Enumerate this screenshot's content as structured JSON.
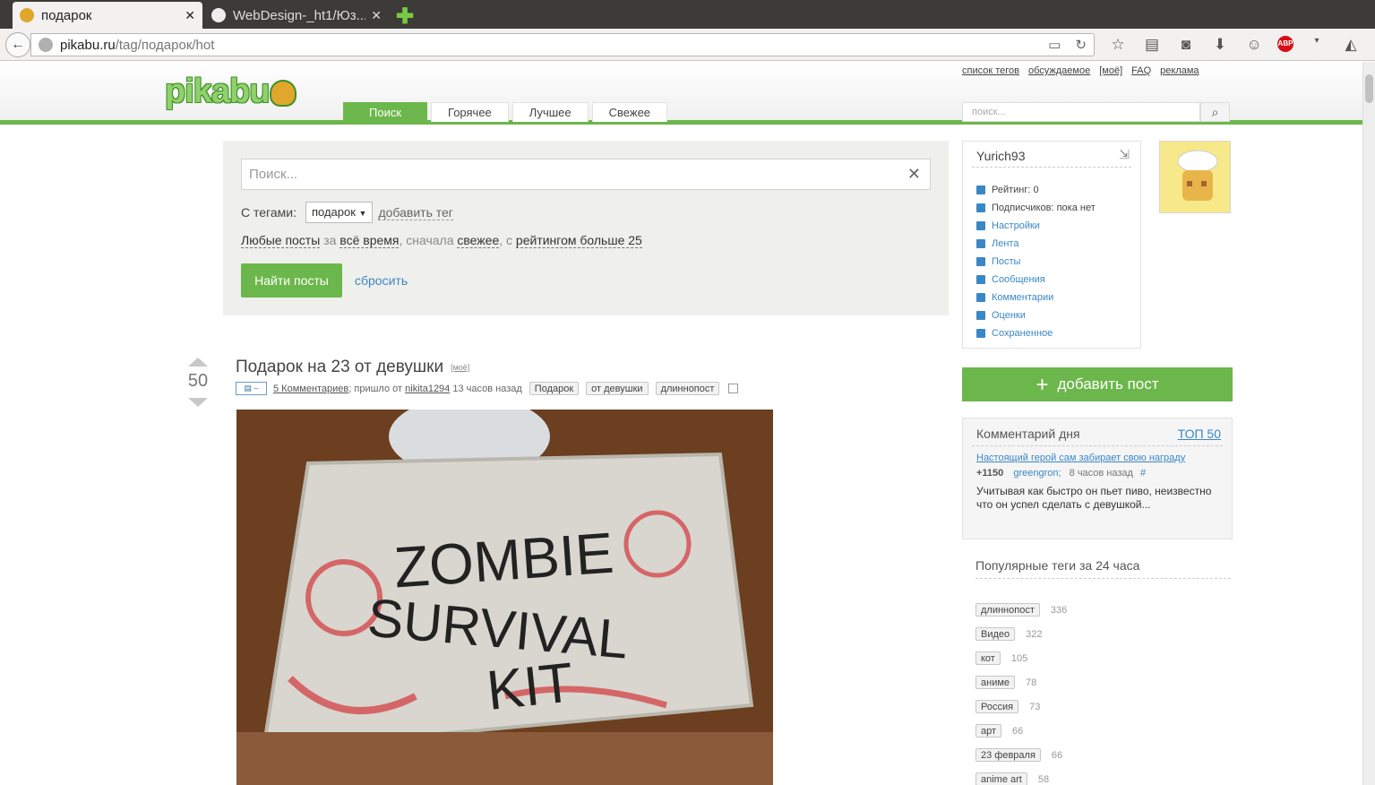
{
  "browser": {
    "tabs": [
      {
        "title": "подарок",
        "active": true
      },
      {
        "title": "WebDesign-_ht1/Юз...",
        "active": false
      }
    ],
    "url_host": "pikabu.ru",
    "url_path": "/tag/подарок/hot"
  },
  "header": {
    "logo_text": "pikabu",
    "top_links": [
      "список тегов",
      "обсуждаемое",
      "[моё]",
      "FAQ",
      "реклама"
    ],
    "nav_tabs": [
      "Поиск",
      "Горячее",
      "Лучшее",
      "Свежее"
    ],
    "search_placeholder": "поиск..."
  },
  "search_panel": {
    "placeholder": "Поиск...",
    "tags_label": "С тегами:",
    "selected_tag": "подарок",
    "add_tag": "добавить тег",
    "filter": {
      "any": "Любые посты",
      "w1": "за",
      "period": "всё время",
      "w2": ", сначала",
      "order": "свежее",
      "w3": ", с",
      "rating": "рейтингом больше 25"
    },
    "find_button": "Найти посты",
    "reset_link": "сбросить"
  },
  "post": {
    "score": "50",
    "title": "Подарок на 23 от девушки",
    "moe": "[моё]",
    "toggle": "▤ –",
    "comments_link": "5 Комментариев",
    "came_from": "; пришло от",
    "author": "nikita1294",
    "time": "13 часов назад",
    "tags": [
      "Подарок",
      "от девушки",
      "длиннопост"
    ],
    "image_text": [
      "ZOMBIE",
      "SURVIVAL",
      "KIT"
    ]
  },
  "user": {
    "name": "Yurich93",
    "rating": "Рейтинг: 0",
    "subscribers": "Подписчиков: пока нет",
    "menu": [
      "Настройки",
      "Лента",
      "Посты",
      "Сообщения",
      "Комментарии",
      "Оценки",
      "Сохраненное"
    ]
  },
  "add_post": "добавить пост",
  "comment_of_day": {
    "heading": "Комментарий дня",
    "top_link": "ТОП 50",
    "post_link": "Настоящий герой сам забирает свою награду",
    "rating": "+1150",
    "author": "greengron;",
    "time": "8 часов назад",
    "hash": "#",
    "text": "Учитывая как быстро он пьет пиво, неизвестно что он успел сделать с девушкой..."
  },
  "popular_tags": {
    "title": "Популярные теги за 24 часа",
    "items": [
      {
        "tag": "длиннопост",
        "count": "336"
      },
      {
        "tag": "Видео",
        "count": "322"
      },
      {
        "tag": "кот",
        "count": "105"
      },
      {
        "tag": "аниме",
        "count": "78"
      },
      {
        "tag": "Россия",
        "count": "73"
      },
      {
        "tag": "арт",
        "count": "66"
      },
      {
        "tag": "23 февраля",
        "count": "66"
      },
      {
        "tag": "anime art",
        "count": "58"
      }
    ]
  },
  "colors": {
    "brand_green": "#6cb74b",
    "link_blue": "#3a87c5"
  }
}
